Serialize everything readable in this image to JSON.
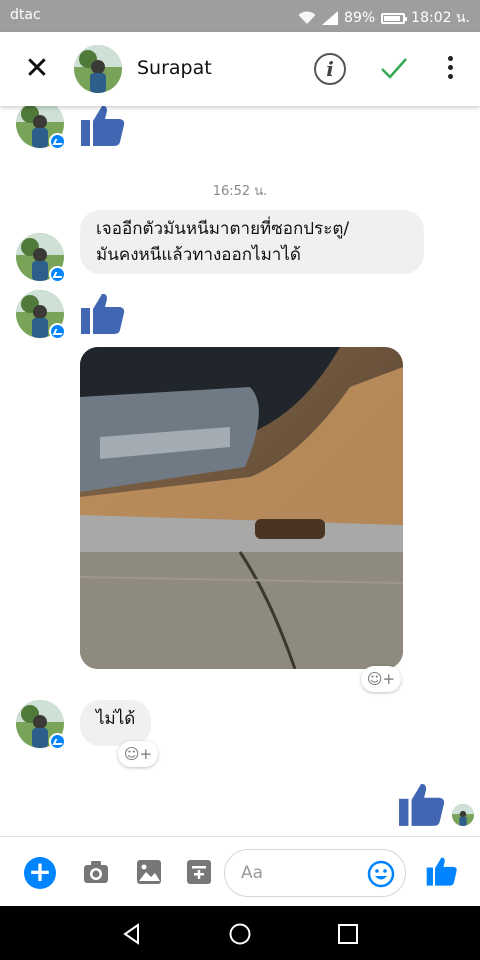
{
  "status_bar": {
    "carrier": "dtac",
    "battery": "89%",
    "battery_level": 0.89,
    "time": "18:02 น."
  },
  "header": {
    "contact_name": "Surapat",
    "icons": [
      "close-icon",
      "info-icon",
      "check-icon",
      "more-vertical-icon"
    ]
  },
  "conversation": {
    "timestamp": "16:52 น.",
    "message_1": "เจออีกตัวมันหนีมาตายที่ซอกประตู/",
    "message_1b": "มันคงหนีแล้วทางออกไมาได้",
    "message_2": "ไม่ได้",
    "reaction_icon": "☺+"
  },
  "composer": {
    "placeholder": "Aa",
    "icons": [
      "plus-icon",
      "camera-icon",
      "gallery-icon",
      "sticker-icon",
      "emoji-icon",
      "like-icon"
    ]
  },
  "colors": {
    "accent": "#0084ff",
    "like": "#4267b2",
    "check": "#34a853",
    "bubble": "#f0f0f0"
  }
}
